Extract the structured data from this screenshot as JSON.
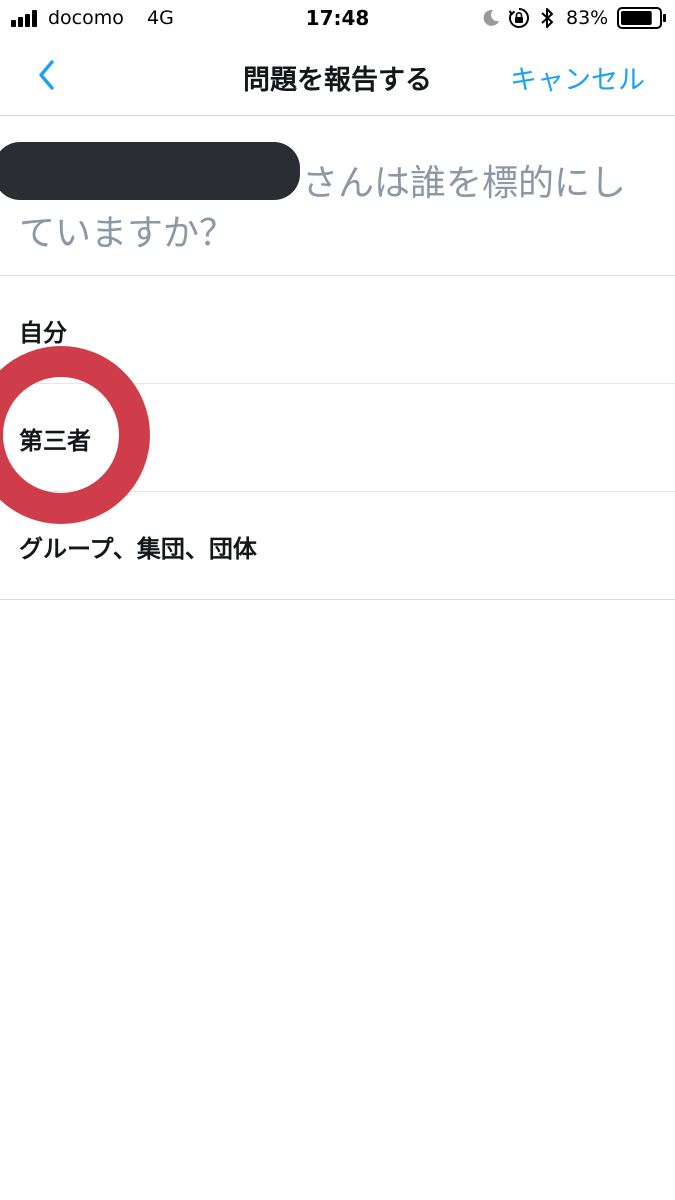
{
  "status_bar": {
    "carrier": "docomo",
    "network": "4G",
    "time": "17:48",
    "battery_percent": "83%",
    "battery_level": 0.83,
    "icons": [
      "signal-icon",
      "moon-icon",
      "orientation-lock-icon",
      "bluetooth-icon",
      "battery-icon"
    ]
  },
  "nav": {
    "title": "問題を報告する",
    "cancel_label": "キャンセル",
    "back_icon": "chevron-left-icon",
    "accent_color": "#1da1f2"
  },
  "question": {
    "line1": "さんは誰を標的にし",
    "line2": "ていますか？"
  },
  "options": [
    {
      "label": "自分"
    },
    {
      "label": "第三者"
    },
    {
      "label": "グループ、集団、団体"
    }
  ],
  "annotation": {
    "shape": "circle",
    "color": "#cf3d4a",
    "highlighted_option": "第三者"
  }
}
